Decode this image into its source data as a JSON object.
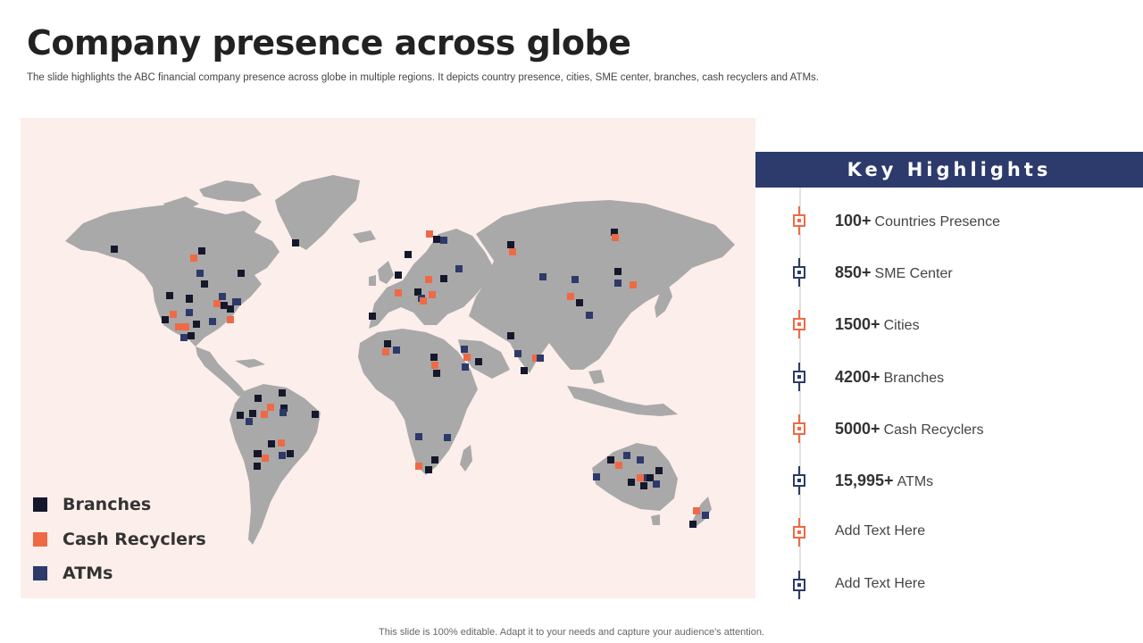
{
  "title": "Company presence across globe",
  "subtitle": "The slide highlights the ABC financial company presence across globe in multiple regions. It depicts country presence, cities, SME center, branches, cash recyclers and ATMs.",
  "colors": {
    "branches": "#15172b",
    "cash_recyclers": "#ee6a47",
    "atms": "#2d3a6a",
    "land": "#a9a9a9",
    "panel": "#fceeeb",
    "header": "#2c3a6c"
  },
  "legend": [
    {
      "label": "Branches",
      "type": "branches"
    },
    {
      "label": "Cash Recyclers",
      "type": "cash_recyclers"
    },
    {
      "label": "ATMs",
      "type": "atms"
    }
  ],
  "key_highlights": {
    "title": "Key Highlights",
    "items": [
      {
        "number": "100+",
        "text": "Countries Presence",
        "type": "cash_recyclers"
      },
      {
        "number": "850+",
        "text": "SME Center",
        "type": "atms"
      },
      {
        "number": "1500+",
        "text": "Cities",
        "type": "cash_recyclers"
      },
      {
        "number": "4200+",
        "text": "Branches",
        "type": "atms"
      },
      {
        "number": "5000+",
        "text": "Cash Recyclers",
        "type": "cash_recyclers"
      },
      {
        "number": "15,995+",
        "text": "ATMs",
        "type": "atms"
      },
      {
        "number": "",
        "text": "Add Text Here",
        "type": "cash_recyclers"
      },
      {
        "number": "",
        "text": "Add Text Here",
        "type": "atms"
      }
    ]
  },
  "footer": "This slide is 100% editable. Adapt it to your needs and capture your audience's attention."
}
